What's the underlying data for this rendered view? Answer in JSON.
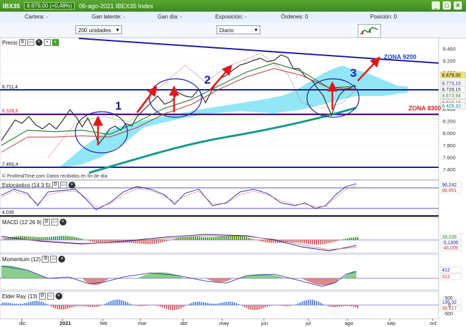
{
  "header": {
    "title": "IBX35",
    "change_badge": "8.879,00 (+0,48%)",
    "subtitle": "06-ago-2021 IBEX35 Index"
  },
  "window_buttons": {
    "min": "_",
    "max": "□",
    "close": "✕"
  },
  "positions_bar": {
    "cartera": "Cartera: -",
    "latente": "Gan latente: -",
    "dia": "Gan día: -",
    "exposicion": "Exposición: -",
    "ordenes": "Órdenes: 0",
    "posicion": "Posición: 0"
  },
  "toolbar": {
    "units": "200 unidades",
    "period": "Diario",
    "logo": "Prorealtime"
  },
  "price_panel": {
    "label": "Precio",
    "watermark": "© ProRealTime.com  Datos recibidos en fin de día",
    "y_ticks": [
      "9.400",
      "9.200",
      "9.000",
      "8.800",
      "8.600",
      "8.400",
      "8.200",
      "8.000",
      "7.800",
      "7.600",
      "7.400"
    ],
    "value_tags": [
      {
        "text": "8.879,00",
        "bg": "#f3e27a",
        "fg": "#000000"
      },
      {
        "text": "8.773,15",
        "bg": "#ffffff",
        "fg": "#2b2b9a"
      },
      {
        "text": "8.729,15",
        "bg": "#ffffff",
        "fg": "#1a1a1a"
      },
      {
        "text": "8.673,94",
        "bg": "#ffffff",
        "fg": "#2e7d32"
      },
      {
        "text": "8.610,15",
        "bg": "#ffffff",
        "fg": "#b33a3a"
      },
      {
        "text": "8.429,32",
        "bg": "#ffffff",
        "fg": "#00897b"
      }
    ],
    "left_levels": [
      "8.711,4",
      "8.328,8",
      "7.450,4"
    ],
    "annotations": {
      "n1": "1",
      "n2": "2",
      "n3": "3",
      "zona_high": "ZONA 9200",
      "zona_low": "ZONA 8300"
    },
    "colors": {
      "line_blue": "#1a1aa0",
      "zona_high": "#1a3dd8",
      "zona_low": "#d42020",
      "arrow": "#dd1a1a",
      "cloud": "#7fe3f4",
      "mm200": "#129a8a"
    }
  },
  "stochastic": {
    "label": "Estocástico (14 3 5)",
    "tags": [
      "96,242",
      "88,651"
    ],
    "left": "4,035"
  },
  "macd": {
    "label": "MACD (12 26 9)",
    "tags": [
      "39,035",
      "-5,1306",
      "-46,005"
    ]
  },
  "momentum": {
    "label": "Momentum (12)",
    "tags": [
      "412",
      "312"
    ]
  },
  "elder": {
    "label": "Elder Ray (13)",
    "tags": [
      "135,32",
      "39,517"
    ],
    "y_ticks": [
      "500",
      "0",
      "-500"
    ]
  },
  "x_axis": {
    "months": [
      "dic",
      "2021",
      "feb",
      "mar",
      "abr",
      "may",
      "jun",
      "jul",
      "ago",
      "sep",
      "oct"
    ]
  }
}
